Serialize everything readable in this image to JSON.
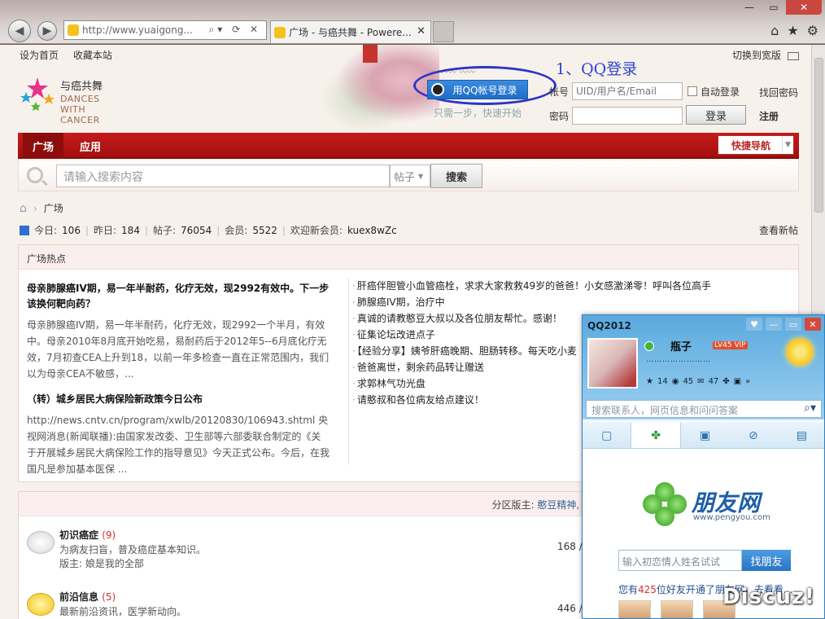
{
  "browser": {
    "address": "http://www.yuaigong...",
    "tab_title": "广场 - 与癌共舞 - Powere...",
    "window_buttons": [
      "minimize-icon",
      "restore-icon",
      "close-icon"
    ],
    "toolbar_icons": [
      "home-icon",
      "star-icon",
      "gear-icon"
    ]
  },
  "topbar": {
    "set_home": "设为首页",
    "bookmark": "收藏本站",
    "wide": "切换到宽版"
  },
  "logo": {
    "cn": "与癌共舞",
    "en": "DANCES WITH CANCER"
  },
  "annotation": {
    "qq_label": "1、QQ登录"
  },
  "qq_login": {
    "button": "用QQ帐号登录",
    "sub": "只需一步，快速开始"
  },
  "login": {
    "account_label": "帐号",
    "account_placeholder": "UID/用户名/Email",
    "auto_login": "自动登录",
    "find_password": "找回密码",
    "password_label": "密码",
    "login_button": "登录",
    "register": "注册"
  },
  "nav": {
    "items": [
      "广场",
      "应用"
    ],
    "quick": "快捷导航"
  },
  "search": {
    "placeholder": "请输入搜索内容",
    "type": "帖子",
    "button": "搜索"
  },
  "breadcrumb": {
    "current": "广场"
  },
  "stats": {
    "today_label": "今日:",
    "today": "106",
    "yesterday_label": "昨日:",
    "yesterday": "184",
    "posts_label": "帖子:",
    "posts": "76054",
    "members_label": "会员:",
    "members": "5522",
    "newest_label": "欢迎新会员:",
    "newest": "kuex8wZc",
    "view_new": "查看新帖"
  },
  "hot": {
    "title": "广场热点",
    "article1_title": "母亲肺腺癌IV期，易一年半耐药，化疗无效，现2992有效中。下一步该换何靶向药？",
    "article1_body": "母亲肺腺癌IV期，易一年半耐药，化疗无效，现2992一个半月，有效中。母亲2010年8月底开始吃易，易耐药后于2012年5--6月底化疗无效，7月初查CEA上升到18，以前一年多检查一直在正常范围内，我们以为母亲CEA不敏感，...",
    "article2_title": "（转）城乡居民大病保险新政策今日公布",
    "article2_body": "http://news.cntv.cn/program/xwlb/20120830/106943.shtml 央视网消息(新闻联播):由国家发改委、卫生部等六部委联合制定的《关于开展城乡居民大病保险工作的指导意见》今天正式公布。今后，在我国凡是参加基本医保 ...",
    "list": [
      "肝癌伴胆管小血管癌栓，求求大家救救49岁的爸爸！小女感激涕零！呼叫各位高手",
      "肺腺癌IV期，治疗中",
      "真诚的请教憨豆大叔以及各位朋友帮忙。感谢！",
      "征集论坛改进点子",
      "【经验分享】姨爷肝癌晚期、胆肠转移。每天吃小麦",
      "爸爸离世，剩余药品转让赠送",
      "求郭林气功光盘",
      "请憨叔和各位病友给点建议！"
    ]
  },
  "forums": {
    "mods_label": "分区版主:",
    "mods": "憨豆精神, 平安！, 老马, 雪绒花, bluest, 枫叶红了, 清逸烦",
    "rows": [
      {
        "name": "初识癌症",
        "count": "(9)",
        "desc": "为病友扫盲，普及癌症基本知识。",
        "mod": "版主: 娘是我的全部",
        "num": "168 /"
      },
      {
        "name": "前沿信息",
        "count": "(5)",
        "desc": "最新前沿资讯，医学新动向。",
        "mod": "",
        "num": "446 /"
      }
    ]
  },
  "qq_panel": {
    "title": "QQ2012",
    "nickname": "瓶子",
    "level": "LV45 VIP",
    "signature": "……………………",
    "icon_counts": [
      "14",
      "45",
      "47"
    ],
    "search_placeholder": "搜索联系人，网页信息和问问答案",
    "brand": "朋友网",
    "brand_url": "www.pengyou.com",
    "find_placeholder": "输入初恋情人姓名试试",
    "find_button": "找朋友",
    "friends_pre": "您有",
    "friends_count": "425",
    "friends_post": "位好友开通了朋友网，去看看..."
  },
  "watermark": "Discuz!"
}
